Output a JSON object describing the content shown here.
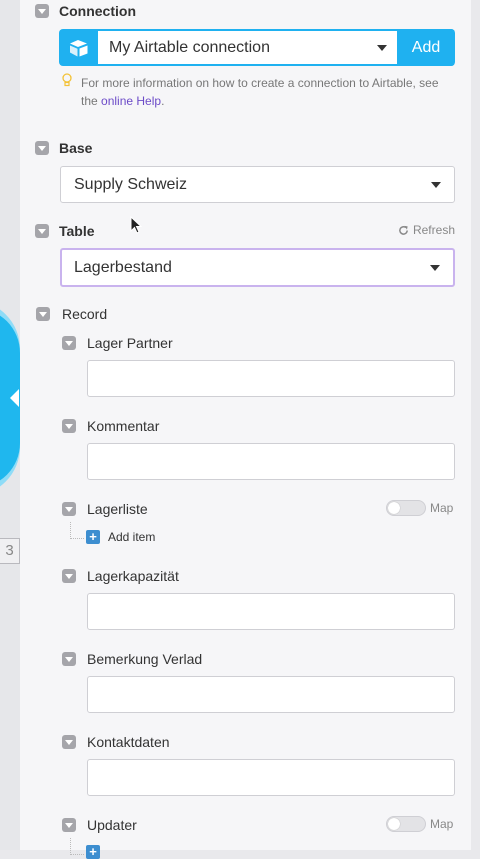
{
  "connection": {
    "label": "Connection",
    "selected": "My Airtable connection",
    "add_label": "Add",
    "hint_text": "For more information on how to create a connection to Airtable, see the ",
    "hint_link": "online Help",
    "hint_end": "."
  },
  "base": {
    "label": "Base",
    "selected": "Supply Schweiz"
  },
  "table": {
    "label": "Table",
    "refresh_label": "Refresh",
    "selected": "Lagerbestand"
  },
  "record": {
    "label": "Record",
    "fields": {
      "lager_partner": "Lager Partner",
      "kommentar": "Kommentar",
      "lagerliste": "Lagerliste",
      "lagerkapazitaet": "Lagerkapazität",
      "bemerkung_verlad": "Bemerkung Verlad",
      "kontaktdaten": "Kontaktdaten",
      "updater": "Updater"
    },
    "map_label": "Map",
    "add_item_label": "Add item"
  },
  "canvas": {
    "module_number": "3"
  },
  "colors": {
    "accent": "#1fb1f0",
    "link": "#6c4bc8",
    "focus": "#c9b3ee"
  }
}
